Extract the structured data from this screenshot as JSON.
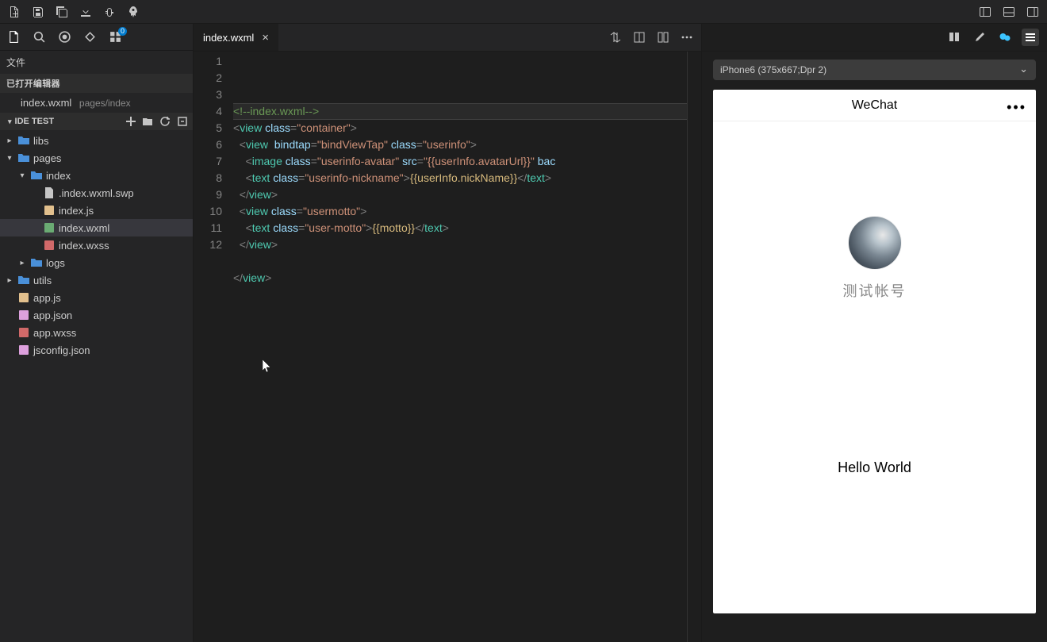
{
  "topbar": {
    "panel_icons": [
      "left-panel",
      "bottom-panel",
      "right-panel"
    ]
  },
  "sidebar": {
    "file_label": "文件",
    "open_editors_label": "已打开编辑器",
    "open_editor": {
      "name": "index.wxml",
      "path": "pages/index"
    },
    "project": {
      "name": "IDE TEST"
    },
    "tree": [
      {
        "label": "libs",
        "type": "folder",
        "depth": 0,
        "caret": "right"
      },
      {
        "label": "pages",
        "type": "folder",
        "depth": 0,
        "caret": "down"
      },
      {
        "label": "index",
        "type": "folder",
        "depth": 1,
        "caret": "down"
      },
      {
        "label": ".index.wxml.swp",
        "type": "file",
        "depth": 2
      },
      {
        "label": "index.js",
        "type": "js",
        "depth": 2
      },
      {
        "label": "index.wxml",
        "type": "wxml",
        "depth": 2,
        "selected": true
      },
      {
        "label": "index.wxss",
        "type": "wxss",
        "depth": 2
      },
      {
        "label": "logs",
        "type": "folder",
        "depth": 1,
        "caret": "right"
      },
      {
        "label": "utils",
        "type": "folder",
        "depth": 0,
        "caret": "right"
      },
      {
        "label": "app.js",
        "type": "js",
        "depth": 0,
        "nocaret": true
      },
      {
        "label": "app.json",
        "type": "json",
        "depth": 0,
        "nocaret": true
      },
      {
        "label": "app.wxss",
        "type": "wxss",
        "depth": 0,
        "nocaret": true
      },
      {
        "label": "jsconfig.json",
        "type": "json",
        "depth": 0,
        "nocaret": true
      }
    ]
  },
  "editor": {
    "tab_name": "index.wxml",
    "line_count": 12,
    "code": {
      "l1_comment": "<!--index.wxml-->",
      "view": "view",
      "class_": "class",
      "container": "\"container\"",
      "bindtap": "bindtap",
      "bindViewTap": "\"bindViewTap\"",
      "userinfo": "\"userinfo\"",
      "image": "image",
      "userinfo_avatar": "\"userinfo-avatar\"",
      "src": "src",
      "avatarUrl": "\"{{userInfo.avatarUrl}}\"",
      "bac": "bac",
      "text": "text",
      "userinfo_nickname": "\"userinfo-nickname\"",
      "nickName": "{{userInfo.nickName}}",
      "usermotto": "\"usermotto\"",
      "user_motto": "\"user-motto\"",
      "motto": "{{motto}}"
    }
  },
  "simulator": {
    "device": "iPhone6 (375x667;Dpr 2)",
    "title": "WeChat",
    "nickname": "测试帐号",
    "motto": "Hello World"
  }
}
